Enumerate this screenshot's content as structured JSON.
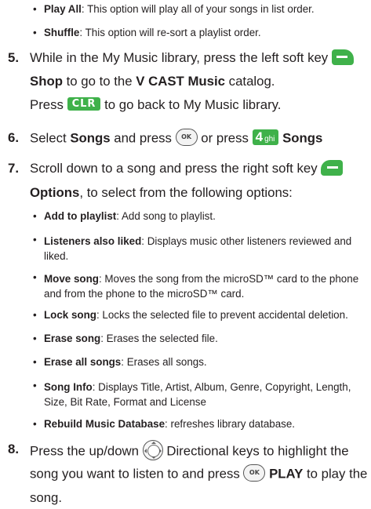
{
  "bullets_top": [
    {
      "bold": "Play All",
      "text": ": This option will play all of your songs in list order."
    },
    {
      "bold": "Shuffle",
      "text": ": This option will re-sort a playlist order."
    }
  ],
  "step5": {
    "num": "5.",
    "line1": "While in the My Music library, press the left soft key",
    "line2_bold_a": "Shop",
    "line2_mid": " to go to the ",
    "line2_bold_b": "V CAST Music",
    "line2_end": " catalog.",
    "line3_a": "Press",
    "clr_label": "CLR",
    "line3_b": " to go back to My Music library."
  },
  "step6": {
    "num": "6.",
    "text_a": "Select ",
    "bold_a": "Songs",
    "text_b": " and press",
    "ok_label": "OK",
    "text_c": " or press",
    "key_digit": "4",
    "key_letters": "ghi",
    "bold_b": "Songs"
  },
  "step7": {
    "num": "7.",
    "line1": "Scroll down to a song and press the right soft key",
    "line2_bold": "Options",
    "line2_text": ", to select from the following options:",
    "options": [
      {
        "bold": "Add to playlist",
        "text": ": Add song to playlist."
      },
      {
        "bold": "Listeners also liked",
        "text": ": Displays music other listeners reviewed and liked."
      },
      {
        "bold": "Move song",
        "text": ": Moves the song from the microSD™ card to the phone and from the phone to the microSD™ card."
      },
      {
        "bold": "Lock song",
        "text": ": Locks the selected file to prevent accidental deletion."
      },
      {
        "bold": "Erase song",
        "text": ": Erases the selected file."
      },
      {
        "bold": "Erase all songs",
        "text": ": Erases all songs."
      },
      {
        "bold": "Song Info",
        "text": ": Displays Title, Artist, Album, Genre, Copyright, Length, Size, Bit Rate, Format and License"
      },
      {
        "bold": "Rebuild Music Database",
        "text": ": refreshes library database."
      }
    ]
  },
  "step8": {
    "num": "8.",
    "text_a": "Press the up/down",
    "text_b": " Directional keys to highlight the",
    "line2_a": "song you want to listen to and press",
    "ok_label": "OK",
    "line2_bold": "PLAY",
    "line2_b": " to play the",
    "line3": "song."
  },
  "icons": {
    "accent_color": "#3fb14a",
    "left_soft_key": "left-soft-key-icon",
    "right_soft_key": "right-soft-key-icon",
    "clr_key": "clr-key-icon",
    "ok_key": "ok-key-icon",
    "key_4": "key-4-icon",
    "directional_key": "directional-key-icon"
  }
}
